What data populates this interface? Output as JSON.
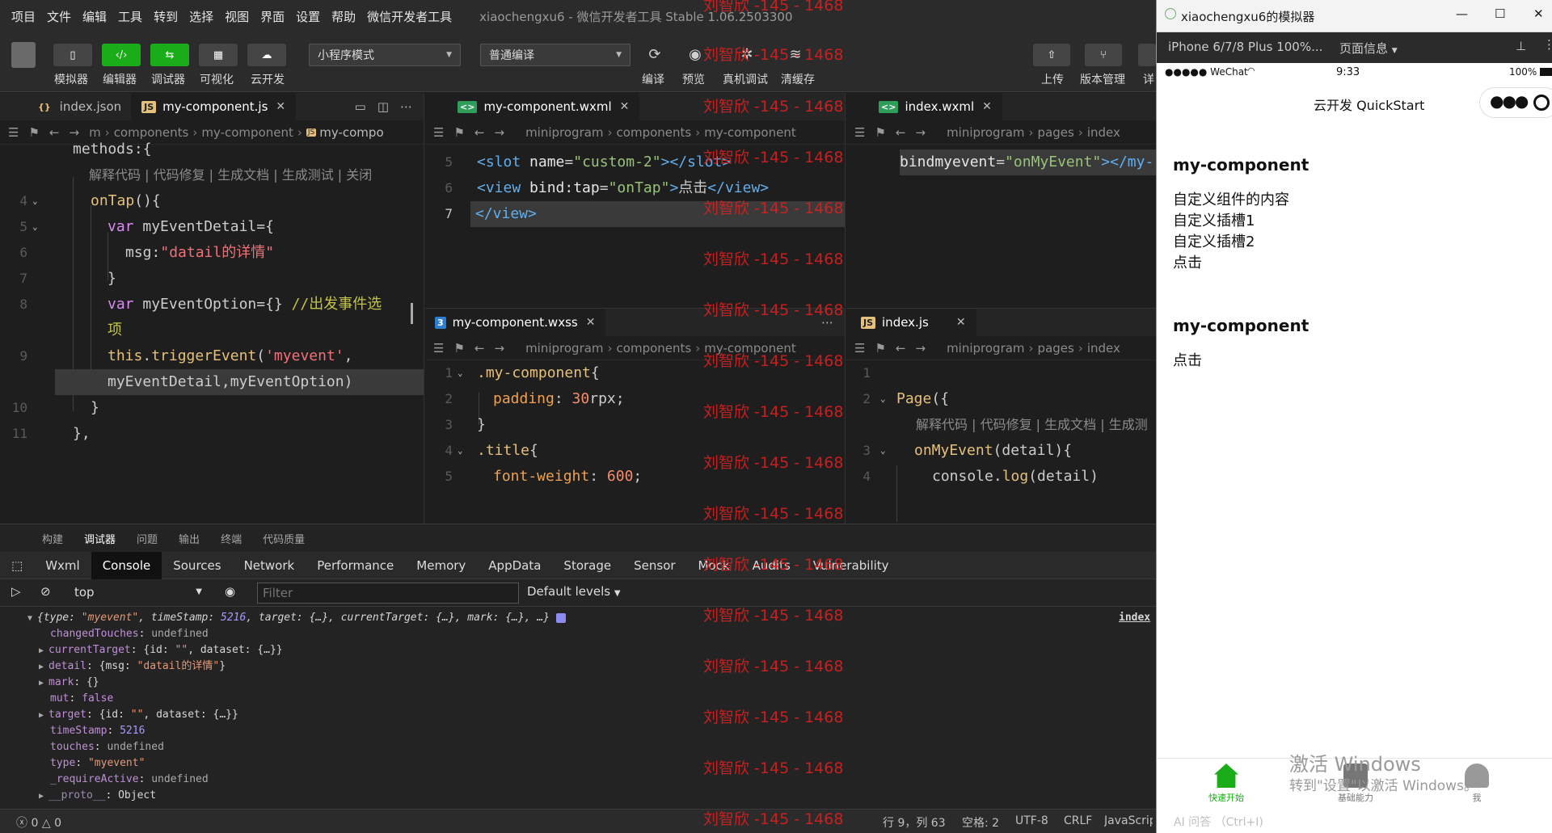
{
  "menu": {
    "items": [
      "项目",
      "文件",
      "编辑",
      "工具",
      "转到",
      "选择",
      "视图",
      "界面",
      "设置",
      "帮助",
      "微信开发者工具"
    ],
    "window_title": "xiaochengxu6 - 微信开发者工具 Stable 1.06.2503300"
  },
  "toolbar": {
    "simulator": "模拟器",
    "editor": "编辑器",
    "debugger": "调试器",
    "visual": "可视化",
    "cloud": "云开发",
    "mode_select": "小程序模式",
    "compile_select": "普通编译",
    "compile": "编译",
    "preview": "预览",
    "real_debug": "真机调试",
    "clear_cache": "清缓存",
    "upload": "上传",
    "version": "版本管理",
    "details": "详"
  },
  "editors": {
    "left": {
      "tabs": [
        "index.json",
        "my-component.js"
      ],
      "crumbs": [
        "m",
        "components",
        "my-component",
        "my-compo"
      ]
    },
    "mid_top": {
      "tab": "my-component.wxml",
      "crumbs": [
        "miniprogram",
        "components",
        "my-component"
      ]
    },
    "right_top": {
      "tab": "index.wxml",
      "crumbs": [
        "miniprogram",
        "pages",
        "index"
      ]
    },
    "mid_bottom": {
      "tab": "my-component.wxss",
      "crumbs": [
        "miniprogram",
        "components",
        "my-component"
      ]
    },
    "right_bottom": {
      "tab": "index.js",
      "crumbs": [
        "miniprogram",
        "pages",
        "index"
      ]
    },
    "codelens": "解释代码 | 代码修复 | 生成文档 | 生成测试 | 关闭",
    "codelens_short": "解释代码 | 代码修复 | 生成文档 | 生成测"
  },
  "bottom_panel": {
    "tabs": [
      "构建",
      "调试器",
      "问题",
      "输出",
      "终端",
      "代码质量"
    ],
    "devtools_tabs": [
      "Wxml",
      "Console",
      "Sources",
      "Network",
      "Performance",
      "Memory",
      "AppData",
      "Storage",
      "Sensor",
      "Mock",
      "Audits",
      "Vulnerability"
    ],
    "context": "top",
    "filter_placeholder": "Filter",
    "levels": "Default levels",
    "source_link": "index"
  },
  "status_bar": {
    "errors": "0",
    "warnings": "0",
    "position": "行 9，列 63",
    "spaces": "空格: 2",
    "encoding": "UTF-8",
    "eol": "CRLF",
    "language": "JavaScript",
    "ai": "AI 问答 （Ctrl+I)"
  },
  "simulator": {
    "title": "xiaochengxu6的模拟器",
    "device": "iPhone 6/7/8 Plus 100%...",
    "page_info": "页面信息",
    "carrier": "●●●●● WeChat",
    "time": "9:33",
    "battery": "100%",
    "nav_title": "云开发 QuickStart",
    "section1_title": "my-component",
    "section1_lines": [
      "自定义组件的内容",
      "自定义插槽1",
      "自定义插槽2",
      "点击"
    ],
    "section2_title": "my-component",
    "section2_line": "点击",
    "tab_quick": "快速开始",
    "tab_basic": "基础能力",
    "tab_me": "我"
  },
  "watermark": "刘智欣 -145 - 1468",
  "windows_activation": {
    "line1": "激活 Windows",
    "line2": "转到\"设置\"以激活 Windows。"
  }
}
